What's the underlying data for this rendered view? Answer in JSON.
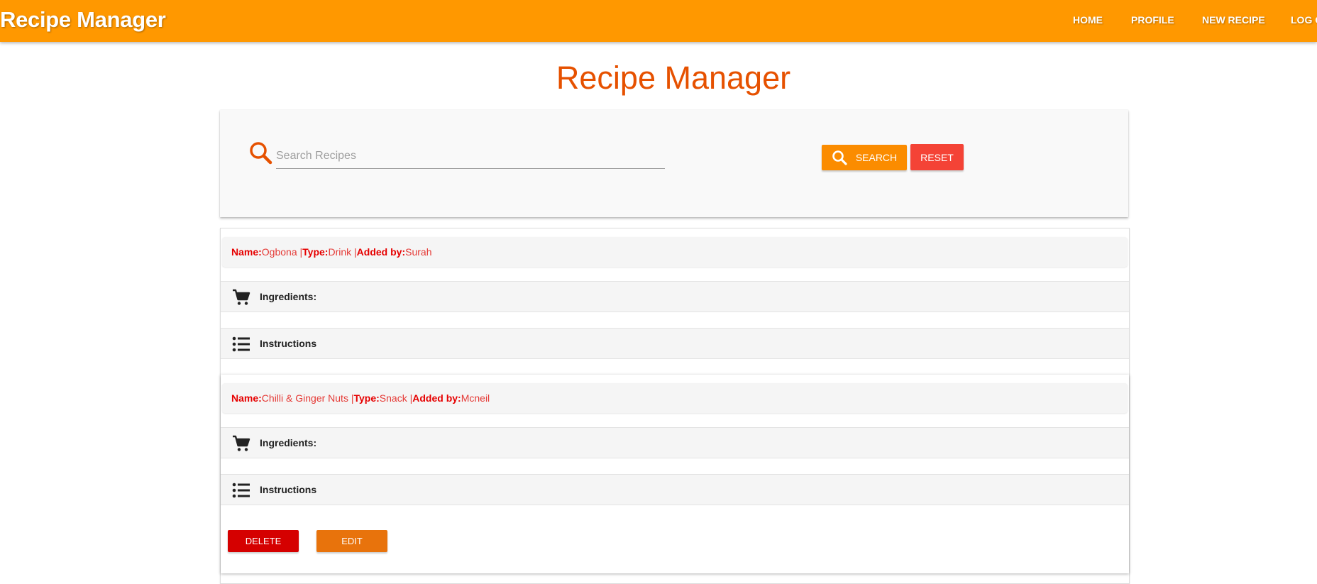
{
  "navbar": {
    "brand": "Recipe Manager",
    "links": [
      "HOME",
      "PROFILE",
      "NEW RECIPE",
      "LOG OUT"
    ]
  },
  "page": {
    "title": "Recipe Manager"
  },
  "search": {
    "placeholder": "Search Recipes",
    "value": "",
    "search_label": "SEARCH",
    "reset_label": "RESET"
  },
  "labels": {
    "name": "Name:",
    "type": "Type:",
    "added_by": "Added by:",
    "sep": " |",
    "ingredients": "Ingredients:",
    "instructions": "Instructions"
  },
  "recipes": [
    {
      "name": "Ogbona",
      "type": "Drink",
      "added_by": "Surah"
    },
    {
      "name": "Chilli & Ginger Nuts",
      "type": "Snack",
      "added_by": "Mcneil",
      "delete_label": "DELETE",
      "edit_label": "EDIT"
    }
  ],
  "colors": {
    "navbar": "#ff9800",
    "title": "#e65100",
    "search_button": "#fb8c00",
    "reset_button": "#f44336",
    "delete_button": "#d50000",
    "edit_button": "#e8730c",
    "header_text": "#e53935"
  },
  "icons": {
    "search": "magnifier-icon",
    "ingredients": "cart-icon",
    "instructions": "list-icon"
  }
}
